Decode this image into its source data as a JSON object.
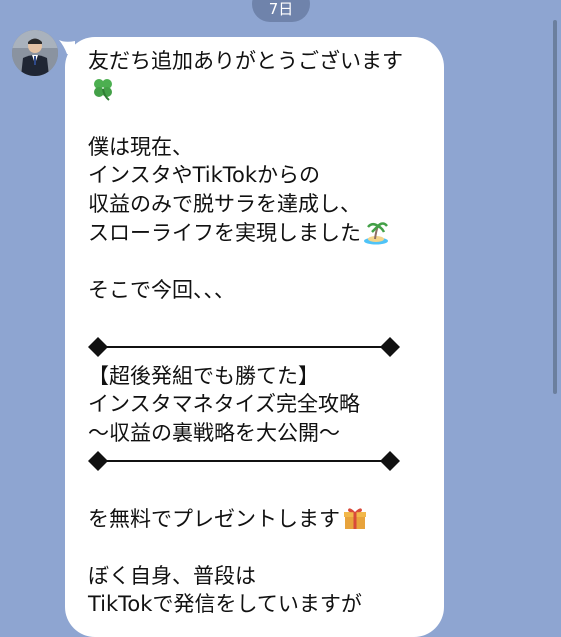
{
  "header": {
    "date_label": "7日"
  },
  "sender": {
    "avatar_icon": "person-photo-icon"
  },
  "message": {
    "greeting": "友だち追加ありがとうございます",
    "greeting_icon": "four-leaf-clover-icon",
    "intro_line1": "僕は現在、",
    "intro_line2": "インスタやTikTokからの",
    "intro_line3": "収益のみで脱サラを達成し、",
    "intro_line4": "スローライフを実現しました",
    "intro_icon": "desert-island-icon",
    "transition": "そこで今回、、、",
    "offer_line1": "【超後発組でも勝てた】",
    "offer_line2": "インスタマネタイズ完全攻略",
    "offer_line3": "〜収益の裏戦略を大公開〜",
    "gift_line": "を無料でプレゼントします",
    "gift_icon": "wrapped-gift-icon",
    "closing_line1": "ぼく自身、普段は",
    "closing_line2": "TikTokで発信をしていますが"
  },
  "colors": {
    "chat_background": "#8ea5d1",
    "bubble": "#ffffff",
    "text": "#111111",
    "date_pill": "#6f83ab"
  }
}
